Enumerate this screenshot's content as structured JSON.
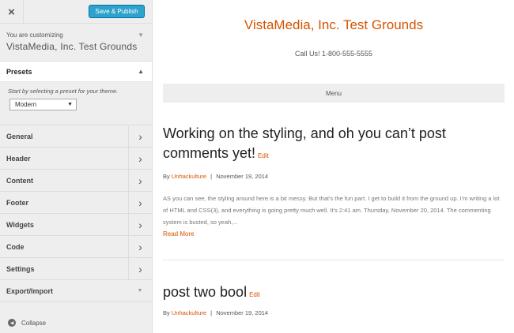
{
  "topbar": {
    "close_icon": "×",
    "save_label": "Save & Publish"
  },
  "customizing": {
    "small": "You are customizing",
    "title": "VistaMedia, Inc. Test Grounds"
  },
  "presets": {
    "title": "Presets",
    "description": "Start by selecting a preset for your theme.",
    "selected": "Modern"
  },
  "sections": [
    {
      "label": "General"
    },
    {
      "label": "Header"
    },
    {
      "label": "Content"
    },
    {
      "label": "Footer"
    },
    {
      "label": "Widgets"
    },
    {
      "label": "Code"
    },
    {
      "label": "Settings"
    },
    {
      "label": "Export/Import"
    }
  ],
  "collapse": {
    "label": "Collapse"
  },
  "site": {
    "title": "VistaMedia, Inc. Test Grounds",
    "phone": "Call Us! 1-800-555-5555",
    "menu": "Menu"
  },
  "posts": [
    {
      "title": "Working on the styling, and oh you can’t post comments yet!",
      "edit": "Edit",
      "by": "By",
      "author": "Unhackulture",
      "separator": "|",
      "date": "November 19, 2014",
      "excerpt": "AS you can see, the styling around here is a bit messy. But that's the fun part. I get to build it from the ground up. I'm writing a lot of HTML and CSS(3), and everything is going pretty much well. It's 2:41 am. Thursday, November 20, 2014. The commenting system is busted, so yeah,...",
      "read_more": "Read More"
    },
    {
      "title": "post two bool",
      "edit": "Edit",
      "by": "By",
      "author": "Unhackulture",
      "separator": "|",
      "date": "November 19, 2014"
    }
  ],
  "colors": {
    "accent": "#d35400",
    "button": "#2ea2cc",
    "sidebar_bg": "#eeeeee"
  }
}
